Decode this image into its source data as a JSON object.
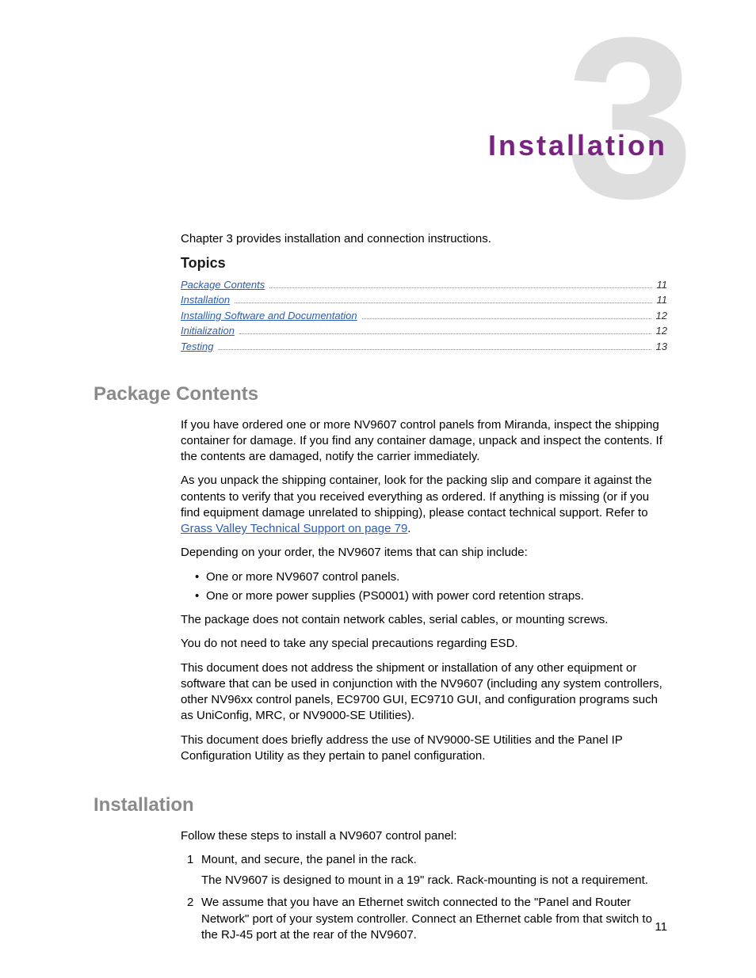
{
  "chapter": {
    "number": "3",
    "title": "Installation",
    "intro": "Chapter 3 provides installation and connection instructions.",
    "topics_heading": "Topics"
  },
  "toc": [
    {
      "label": "Package Contents",
      "page": "11"
    },
    {
      "label": "Installation",
      "page": "11"
    },
    {
      "label": "Installing Software and Documentation",
      "page": "12"
    },
    {
      "label": "Initialization",
      "page": "12"
    },
    {
      "label": "Testing",
      "page": "13"
    }
  ],
  "section1": {
    "heading": "Package Contents",
    "p1": "If you have ordered one or more NV9607 control panels from Miranda, inspect the shipping container for damage. If you find any container damage, unpack and inspect the contents. If the contents are damaged, notify the carrier immediately.",
    "p2a": "As you unpack the shipping container, look for the packing slip and compare it against the contents to verify that you received everything as ordered. If anything is missing (or if you find equipment damage unrelated to shipping), please contact technical support. Refer to ",
    "p2_link": "Grass Valley Technical Support on page 79",
    "p2b": ".",
    "p3": "Depending on your order, the NV9607 items that can ship include:",
    "bullets": [
      "One or more NV9607 control panels.",
      "One or more power supplies (PS0001) with power cord retention straps."
    ],
    "p4": "The package does not contain network cables, serial cables, or mounting screws.",
    "p5": "You do not need to take any special precautions regarding ESD.",
    "p6": "This document does not address the shipment or installation of any other equipment or software that can be used in conjunction with the NV9607 (including any system controllers, other NV96xx control panels, EC9700 GUI, EC9710 GUI, and configuration programs such as UniConfig, MRC, or NV9000-SE Utilities).",
    "p7": "This document does briefly address the use of NV9000-SE Utilities and the Panel IP Configuration Utility as they pertain to panel configuration."
  },
  "section2": {
    "heading": "Installation",
    "intro": "Follow these steps to install a NV9607 control panel:",
    "steps": [
      {
        "num": "1",
        "text": "Mount, and secure, the panel in the rack.",
        "sub": "The NV9607 is designed to mount in a 19\" rack. Rack-mounting is not a requirement."
      },
      {
        "num": "2",
        "text": "We assume that you have an Ethernet switch connected to the \"Panel and Router Network\" port of your system controller. Connect an Ethernet cable from that switch to the RJ-45 port at the rear of the NV9607."
      }
    ]
  },
  "page_number": "11"
}
